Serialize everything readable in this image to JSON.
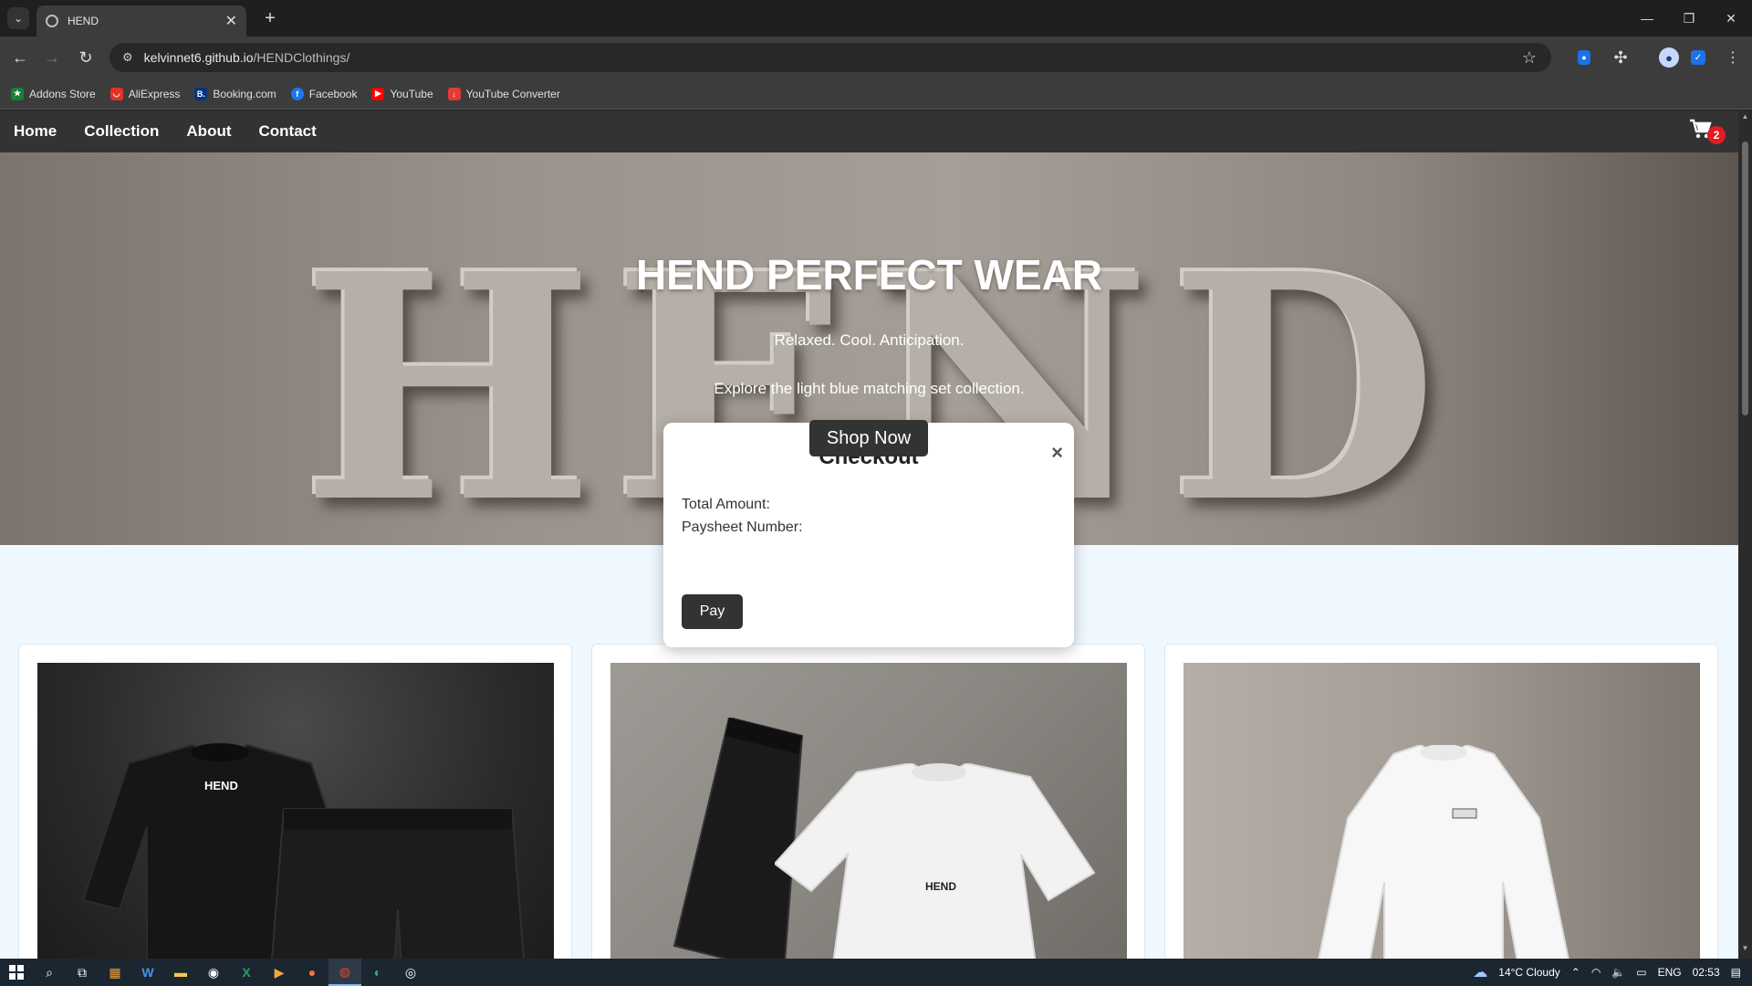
{
  "browser": {
    "tab_title": "HEND",
    "url_host": "kelvinnet6.github.io",
    "url_path": "/HENDClothings/",
    "bookmarks": [
      {
        "label": "Addons Store",
        "color": "#1a7f37"
      },
      {
        "label": "AliExpress",
        "color": "#e43225"
      },
      {
        "label": "Booking.com",
        "color": "#003580"
      },
      {
        "label": "Facebook",
        "color": "#1877f2"
      },
      {
        "label": "YouTube",
        "color": "#ff0000"
      },
      {
        "label": "YouTube Converter",
        "color": "#e53935"
      }
    ]
  },
  "site": {
    "nav": [
      "Home",
      "Collection",
      "About",
      "Contact"
    ],
    "cart_count": "2",
    "hero": {
      "background_text": "HEND",
      "title": "HEND PERFECT WEAR",
      "tagline": "Relaxed. Cool. Anticipation.",
      "description": "Explore the light blue matching set collection.",
      "cta": "Shop Now"
    },
    "products": [
      {
        "photo": "black sweatshirt and shorts set",
        "brand_text": "HEND"
      },
      {
        "photo": "white t-shirt with black shorts",
        "brand_text": "HEND"
      },
      {
        "photo": "white long-sleeve sweatshirt",
        "brand_text": ""
      }
    ]
  },
  "checkout": {
    "title": "Checkout",
    "total_label": "Total Amount:",
    "paysheet_label": "Paysheet Number:",
    "pay_button": "Pay",
    "close": "×"
  },
  "taskbar": {
    "weather": "14°C  Cloudy",
    "language": "ENG",
    "time": "02:53"
  },
  "colors": {
    "nav_bg": "#333333",
    "page_bg": "#f0f8ff",
    "cart_badge": "#e31b23",
    "button_bg": "#333333"
  }
}
